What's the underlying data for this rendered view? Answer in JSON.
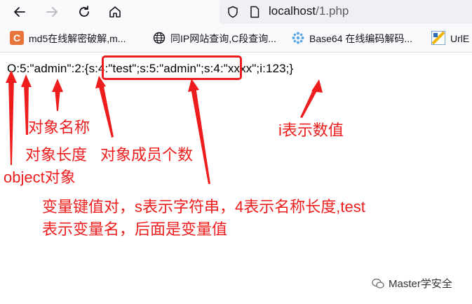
{
  "browser": {
    "url_host": "localhost",
    "url_path": "/1.php",
    "bookmarks": [
      {
        "label": "md5在线解密破解,m...",
        "icon": "c-logo-icon"
      },
      {
        "label": "同IP网站查询,C段查询...",
        "icon": "globe-icon"
      },
      {
        "label": "Base64 在线编码解码...",
        "icon": "gear-dots-icon"
      },
      {
        "label": "UrlE",
        "icon": "urle-logo-icon"
      }
    ]
  },
  "content": {
    "serialized_string": "O:5:\"admin\":2:{s:4:\"test\";s:5:\"admin\";s:4:\"xxxx\";i:123;}"
  },
  "annotations": {
    "object": "object对象",
    "class_name_length": "对象长度",
    "class_name": "对象名称",
    "member_count": "对象成员个数",
    "int_type": "i表示数值",
    "kv_line1": "变量键值对，s表示字符串，4表示名称长度,test",
    "kv_line2": "表示变量名，后面是变量值"
  },
  "colors": {
    "annotation": "#ee1c1c",
    "text": "#000000"
  },
  "watermark": "Master学安全"
}
